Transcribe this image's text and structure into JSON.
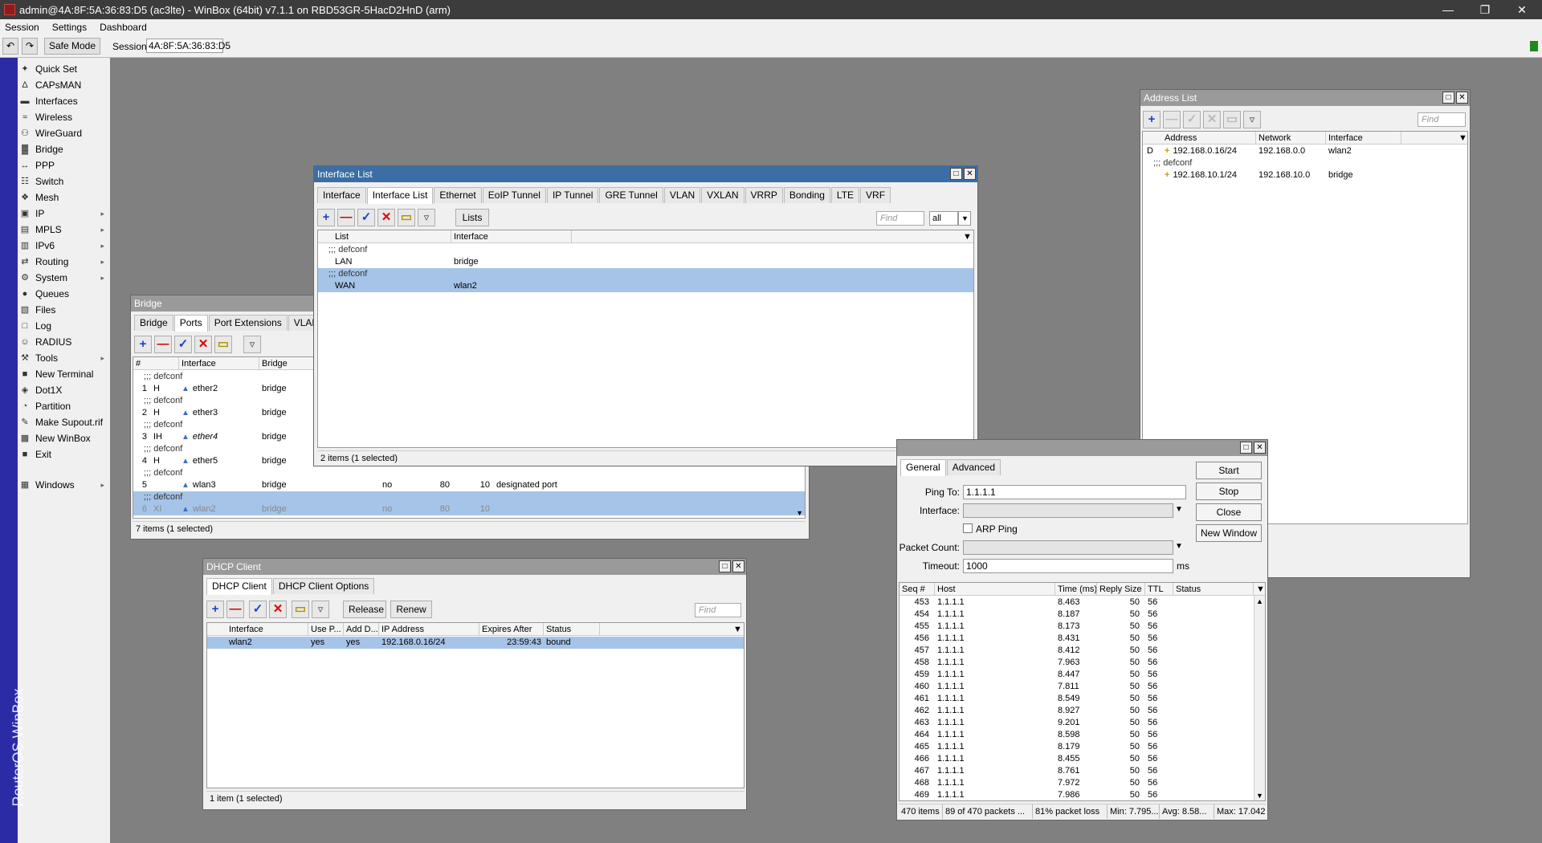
{
  "window": {
    "title": "admin@4A:8F:5A:36:83:D5 (ac3lte) - WinBox (64bit) v7.1.1 on RBD53GR-5HacD2HnD (arm)"
  },
  "menu": [
    "Session",
    "Settings",
    "Dashboard"
  ],
  "toolbar": {
    "safe_mode": "Safe Mode",
    "session_label": "Session:",
    "session_value": "4A:8F:5A:36:83:D5"
  },
  "sidebar": {
    "brand": "RouterOS WinBox",
    "items": [
      {
        "label": "Quick Set",
        "icon": "wand-icon",
        "sub": false
      },
      {
        "label": "CAPsMAN",
        "icon": "antenna-icon",
        "sub": false
      },
      {
        "label": "Interfaces",
        "icon": "interfaces-icon",
        "sub": false
      },
      {
        "label": "Wireless",
        "icon": "wireless-icon",
        "sub": false
      },
      {
        "label": "WireGuard",
        "icon": "wireguard-icon",
        "sub": false
      },
      {
        "label": "Bridge",
        "icon": "bridge-icon",
        "sub": false
      },
      {
        "label": "PPP",
        "icon": "ppp-icon",
        "sub": false
      },
      {
        "label": "Switch",
        "icon": "switch-icon",
        "sub": false
      },
      {
        "label": "Mesh",
        "icon": "mesh-icon",
        "sub": false
      },
      {
        "label": "IP",
        "icon": "ip-icon",
        "sub": true
      },
      {
        "label": "MPLS",
        "icon": "mpls-icon",
        "sub": true
      },
      {
        "label": "IPv6",
        "icon": "ipv6-icon",
        "sub": true
      },
      {
        "label": "Routing",
        "icon": "routing-icon",
        "sub": true
      },
      {
        "label": "System",
        "icon": "system-icon",
        "sub": true
      },
      {
        "label": "Queues",
        "icon": "queues-icon",
        "sub": false
      },
      {
        "label": "Files",
        "icon": "files-icon",
        "sub": false
      },
      {
        "label": "Log",
        "icon": "log-icon",
        "sub": false
      },
      {
        "label": "RADIUS",
        "icon": "radius-icon",
        "sub": false
      },
      {
        "label": "Tools",
        "icon": "tools-icon",
        "sub": true
      },
      {
        "label": "New Terminal",
        "icon": "terminal-icon",
        "sub": false
      },
      {
        "label": "Dot1X",
        "icon": "dot1x-icon",
        "sub": false
      },
      {
        "label": "Partition",
        "icon": "partition-icon",
        "sub": false
      },
      {
        "label": "Make Supout.rif",
        "icon": "supout-icon",
        "sub": false
      },
      {
        "label": "New WinBox",
        "icon": "winbox-icon",
        "sub": false
      },
      {
        "label": "Exit",
        "icon": "exit-icon",
        "sub": false
      }
    ],
    "windows": {
      "label": "Windows",
      "icon": "windows-icon"
    }
  },
  "address_list": {
    "title": "Address List",
    "find": "Find",
    "columns": [
      "Address",
      "Network",
      "Interface"
    ],
    "rows": [
      {
        "flag": "D",
        "comment": "",
        "address": "192.168.0.16/24",
        "network": "192.168.0.0",
        "interface": "wlan2"
      },
      {
        "flag": "",
        "comment": ";;; defconf",
        "address": "",
        "network": "",
        "interface": ""
      },
      {
        "flag": "",
        "comment": "",
        "address": "192.168.10.1/24",
        "network": "192.168.10.0",
        "interface": "bridge"
      }
    ]
  },
  "interface_list": {
    "title": "Interface List",
    "tabs": [
      "Interface",
      "Interface List",
      "Ethernet",
      "EoIP Tunnel",
      "IP Tunnel",
      "GRE Tunnel",
      "VLAN",
      "VXLAN",
      "VRRP",
      "Bonding",
      "LTE",
      "VRF"
    ],
    "lists_button": "Lists",
    "find": "Find",
    "filter_value": "all",
    "columns": [
      "List",
      "Interface"
    ],
    "rows": [
      {
        "comment": ";;; defconf",
        "list": "",
        "interface": "",
        "sel": false
      },
      {
        "comment": "",
        "list": "LAN",
        "interface": "bridge",
        "sel": false
      },
      {
        "comment": ";;; defconf",
        "list": "",
        "interface": "",
        "sel": true
      },
      {
        "comment": "",
        "list": "WAN",
        "interface": "wlan2",
        "sel": true
      }
    ],
    "status": "2 items (1 selected)"
  },
  "bridge": {
    "title": "Bridge",
    "tabs": [
      "Bridge",
      "Ports",
      "Port Extensions",
      "VLANs"
    ],
    "columns": [
      "#",
      "Interface",
      "Bridge"
    ],
    "rows": [
      {
        "comment": ";;; defconf"
      },
      {
        "num": "1",
        "flags": "H",
        "interface": "ether2",
        "bridge": "bridge"
      },
      {
        "comment": ";;; defconf"
      },
      {
        "num": "2",
        "flags": "H",
        "interface": "ether3",
        "bridge": "bridge"
      },
      {
        "comment": ";;; defconf"
      },
      {
        "num": "3",
        "flags": "IH",
        "interface": "ether4",
        "bridge": "bridge",
        "italic": true
      },
      {
        "comment": ";;; defconf"
      },
      {
        "num": "4",
        "flags": "H",
        "interface": "ether5",
        "bridge": "bridge"
      },
      {
        "comment": ";;; defconf"
      },
      {
        "num": "5",
        "flags": "",
        "interface": "wlan3",
        "bridge": "bridge",
        "c1": "no",
        "c2": "80",
        "c3": "10",
        "c4": "designated port"
      },
      {
        "comment": ";;; defconf",
        "sel": true,
        "dim": true
      },
      {
        "num": "6",
        "flags": "XI",
        "interface": "wlan2",
        "bridge": "bridge",
        "c1": "no",
        "c2": "80",
        "c3": "10",
        "sel": true,
        "dim": true
      }
    ],
    "status": "7 items (1 selected)"
  },
  "dhcp_client": {
    "title": "DHCP Client",
    "tabs": [
      "DHCP Client",
      "DHCP Client Options"
    ],
    "release": "Release",
    "renew": "Renew",
    "find": "Find",
    "columns": [
      "Interface",
      "Use P...",
      "Add D...",
      "IP Address",
      "Expires After",
      "Status"
    ],
    "rows": [
      {
        "interface": "wlan2",
        "use_peer": "yes",
        "add_default": "yes",
        "ip": "192.168.0.16/24",
        "expires": "23:59:43",
        "status": "bound"
      }
    ],
    "status": "1 item (1 selected)"
  },
  "ping": {
    "tabs": [
      "General",
      "Advanced"
    ],
    "ping_to_label": "Ping To:",
    "ping_to": "1.1.1.1",
    "interface_label": "Interface:",
    "arp_ping": "ARP Ping",
    "packet_count_label": "Packet Count:",
    "timeout_label": "Timeout:",
    "timeout": "1000",
    "timeout_unit": "ms",
    "buttons": [
      "Start",
      "Stop",
      "Close",
      "New Window"
    ],
    "columns": [
      "Seq #",
      "Host",
      "Time (ms)",
      "Reply Size",
      "TTL",
      "Status"
    ],
    "rows": [
      {
        "seq": "453",
        "host": "1.1.1.1",
        "time": "8.463",
        "size": "50",
        "ttl": "56"
      },
      {
        "seq": "454",
        "host": "1.1.1.1",
        "time": "8.187",
        "size": "50",
        "ttl": "56"
      },
      {
        "seq": "455",
        "host": "1.1.1.1",
        "time": "8.173",
        "size": "50",
        "ttl": "56"
      },
      {
        "seq": "456",
        "host": "1.1.1.1",
        "time": "8.431",
        "size": "50",
        "ttl": "56"
      },
      {
        "seq": "457",
        "host": "1.1.1.1",
        "time": "8.412",
        "size": "50",
        "ttl": "56"
      },
      {
        "seq": "458",
        "host": "1.1.1.1",
        "time": "7.963",
        "size": "50",
        "ttl": "56"
      },
      {
        "seq": "459",
        "host": "1.1.1.1",
        "time": "8.447",
        "size": "50",
        "ttl": "56"
      },
      {
        "seq": "460",
        "host": "1.1.1.1",
        "time": "7.811",
        "size": "50",
        "ttl": "56"
      },
      {
        "seq": "461",
        "host": "1.1.1.1",
        "time": "8.549",
        "size": "50",
        "ttl": "56"
      },
      {
        "seq": "462",
        "host": "1.1.1.1",
        "time": "8.927",
        "size": "50",
        "ttl": "56"
      },
      {
        "seq": "463",
        "host": "1.1.1.1",
        "time": "9.201",
        "size": "50",
        "ttl": "56"
      },
      {
        "seq": "464",
        "host": "1.1.1.1",
        "time": "8.598",
        "size": "50",
        "ttl": "56"
      },
      {
        "seq": "465",
        "host": "1.1.1.1",
        "time": "8.179",
        "size": "50",
        "ttl": "56"
      },
      {
        "seq": "466",
        "host": "1.1.1.1",
        "time": "8.455",
        "size": "50",
        "ttl": "56"
      },
      {
        "seq": "467",
        "host": "1.1.1.1",
        "time": "8.761",
        "size": "50",
        "ttl": "56"
      },
      {
        "seq": "468",
        "host": "1.1.1.1",
        "time": "7.972",
        "size": "50",
        "ttl": "56"
      },
      {
        "seq": "469",
        "host": "1.1.1.1",
        "time": "7.986",
        "size": "50",
        "ttl": "56"
      }
    ],
    "status": [
      "470 items",
      "89 of 470 packets ...",
      "81% packet loss",
      "Min: 7.795...",
      "Avg: 8.58...",
      "Max: 17.042..."
    ]
  }
}
